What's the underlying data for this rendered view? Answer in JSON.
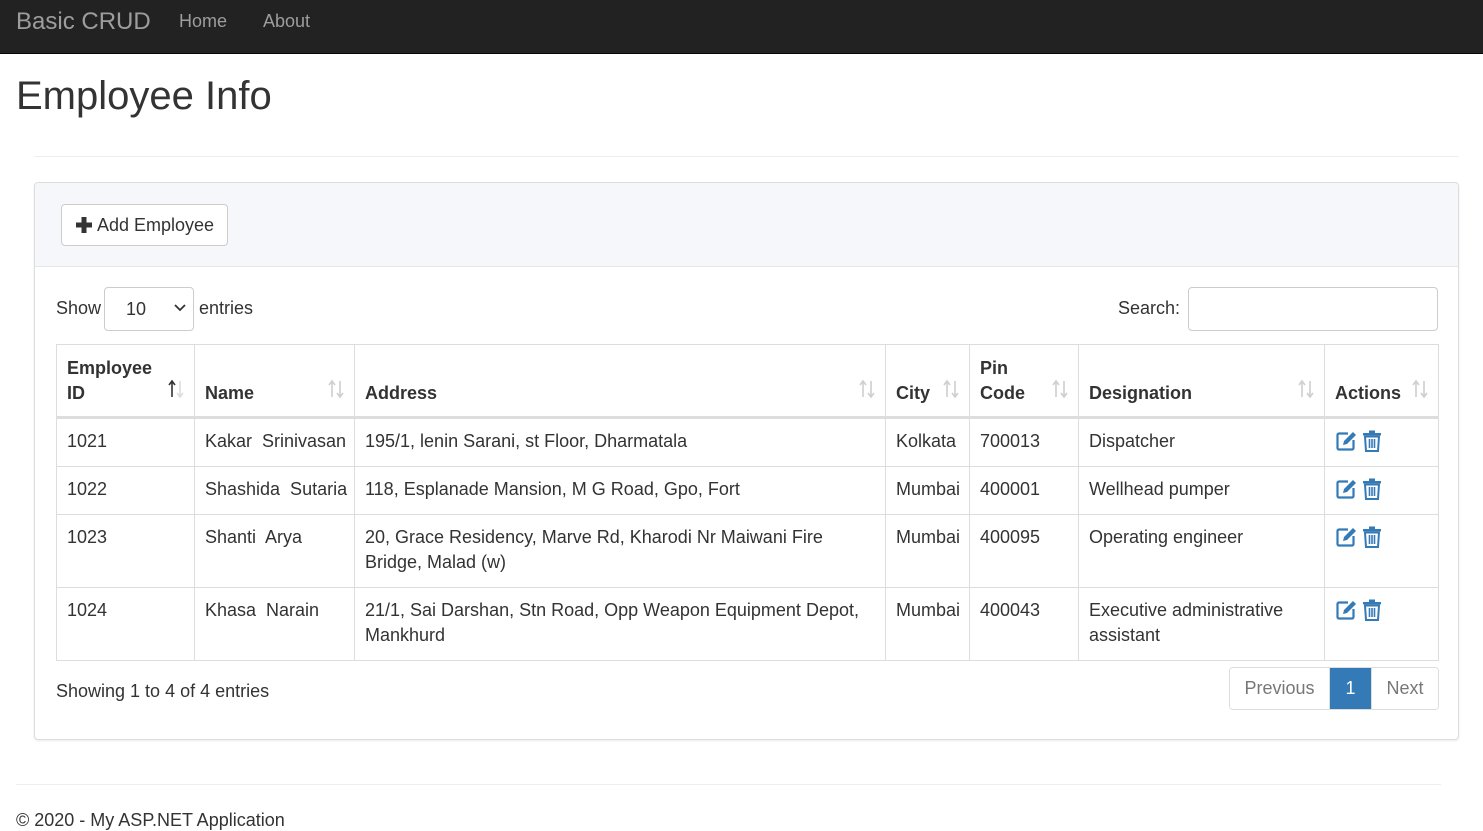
{
  "navbar": {
    "brand": "Basic CRUD",
    "links": [
      "Home",
      "About"
    ]
  },
  "page": {
    "title": "Employee Info"
  },
  "panel": {
    "add_button_label": "Add Employee"
  },
  "table_controls": {
    "show_label": "Show",
    "page_size": "10",
    "entries_label": "entries",
    "search_label": "Search:",
    "search_value": ""
  },
  "table": {
    "columns": [
      "Employee ID",
      "Name",
      "Address",
      "City",
      "Pin Code",
      "Designation",
      "Actions"
    ],
    "rows": [
      [
        "1021",
        "Kakar  Srinivasan",
        "195/1, lenin Sarani, st Floor, Dharmatala",
        "Kolkata",
        "700013",
        "Dispatcher"
      ],
      [
        "1022",
        "Shashida  Sutaria",
        "118, Esplanade Mansion, M G Road, Gpo, Fort",
        "Mumbai",
        "400001",
        "Wellhead pumper"
      ],
      [
        "1023",
        "Shanti  Arya",
        "20, Grace Residency, Marve Rd, Kharodi Nr Maiwani Fire Bridge, Malad (w)",
        "Mumbai",
        "400095",
        "Operating engineer"
      ],
      [
        "1024",
        "Khasa  Narain",
        "21/1, Sai Darshan, Stn Road, Opp Weapon Equipment Depot, Mankhurd",
        "Mumbai",
        "400043",
        "Executive administrative assistant"
      ]
    ],
    "row_action_icons": [
      "edit-icon",
      "trash-icon"
    ],
    "sort_icon": "sort-icon"
  },
  "info": {
    "text": "Showing 1 to 4 of 4 entries"
  },
  "pagination": {
    "previous": "Previous",
    "current": "1",
    "next": "Next"
  },
  "footer": {
    "text": "© 2020 - My ASP.NET Application"
  },
  "colors": {
    "navbar": "#222222",
    "accent": "#337ab7",
    "panel_heading": "#f5f7fa"
  }
}
